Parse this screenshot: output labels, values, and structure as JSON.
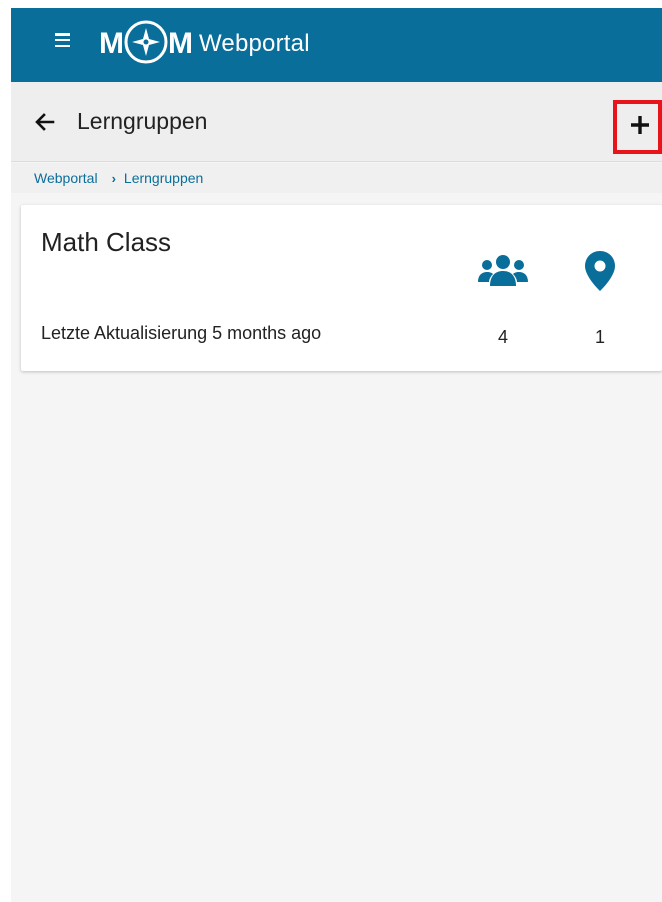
{
  "header": {
    "logo_letter_left": "M",
    "logo_letter_right": "M",
    "logo_text": "Webportal",
    "menu_icon": "hamburger-icon",
    "brand_color": "#0a6e9b"
  },
  "subheader": {
    "back_icon": "arrow-left-icon",
    "title": "Lerngruppen",
    "add_icon": "plus-icon"
  },
  "breadcrumb": {
    "items": [
      "Webportal",
      "Lerngruppen"
    ],
    "separator_icon": "chevron-right-icon"
  },
  "groups": [
    {
      "name": "Math Class",
      "updated": "Letzte Aktualisierung 5 months ago",
      "members_icon": "users-icon",
      "members_count": "4",
      "locations_icon": "location-pin-icon",
      "locations_count": "1"
    }
  ]
}
